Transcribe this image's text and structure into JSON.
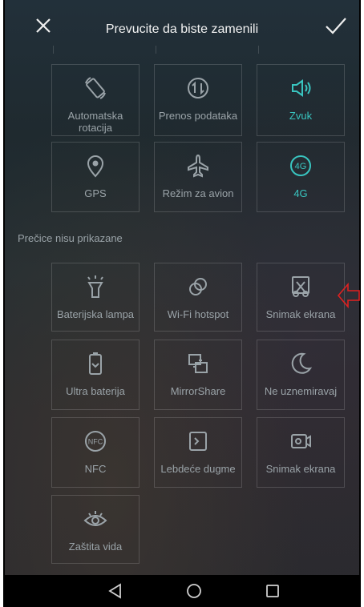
{
  "header": {
    "title": "Prevucite da biste zamenili"
  },
  "section_label": "Prečice nisu prikazane",
  "active_tiles": [
    {
      "label": "Automatska rotacija"
    },
    {
      "label": "Prenos podataka"
    },
    {
      "label": "Zvuk"
    },
    {
      "label": "GPS"
    },
    {
      "label": "Režim za avion"
    },
    {
      "label": "4G"
    }
  ],
  "hidden_tiles": [
    {
      "label": "Baterijska lampa"
    },
    {
      "label": "Wi-Fi hotspot"
    },
    {
      "label": "Snimak ekrana"
    },
    {
      "label": "Ultra baterija"
    },
    {
      "label": "MirrorShare"
    },
    {
      "label": "Ne uznemiravaj"
    },
    {
      "label": "NFC"
    },
    {
      "label": "Lebdeće dugme"
    },
    {
      "label": "Snimak ekrana"
    },
    {
      "label": "Zaštita vida"
    }
  ],
  "colors": {
    "accent": "#39c5c0",
    "annotation_arrow": "#e02020"
  }
}
